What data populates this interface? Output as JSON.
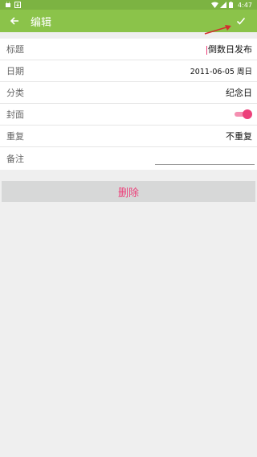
{
  "statusbar": {
    "time": "4:47"
  },
  "toolbar": {
    "title": "编辑"
  },
  "form": {
    "title_label": "标题",
    "title_value": "倒数日发布",
    "date_label": "日期",
    "date_value": "2011-06-05 周日",
    "category_label": "分类",
    "category_value": "纪念日",
    "cover_label": "封面",
    "cover_enabled": true,
    "repeat_label": "重复",
    "repeat_value": "不重复",
    "note_label": "备注",
    "note_value": ""
  },
  "delete_label": "删除",
  "colors": {
    "toolbar": "#8bc34a",
    "statusbar": "#7cb342",
    "accent": "#ec407a"
  }
}
